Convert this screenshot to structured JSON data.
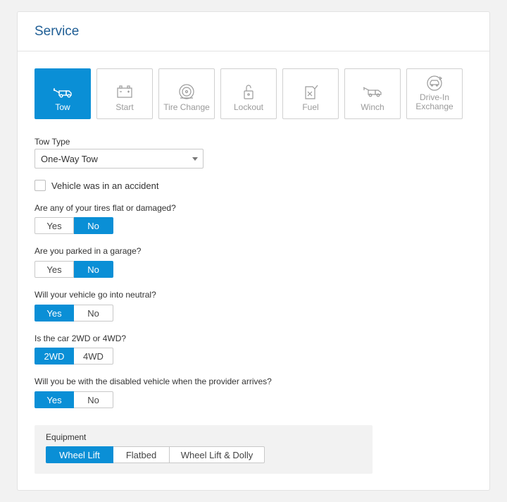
{
  "header": {
    "title": "Service"
  },
  "services": [
    {
      "label": "Tow",
      "icon": "tow-truck-icon",
      "active": true
    },
    {
      "label": "Start",
      "icon": "battery-icon",
      "active": false
    },
    {
      "label": "Tire Change",
      "icon": "tire-icon",
      "active": false
    },
    {
      "label": "Lockout",
      "icon": "unlock-icon",
      "active": false
    },
    {
      "label": "Fuel",
      "icon": "fuel-can-icon",
      "active": false
    },
    {
      "label": "Winch",
      "icon": "winch-truck-icon",
      "active": false
    },
    {
      "label": "Drive-In Exchange",
      "label_line1": "Drive-In",
      "label_line2": "Exchange",
      "icon": "car-exchange-icon",
      "active": false
    }
  ],
  "tow_type": {
    "label": "Tow Type",
    "value": "One-Way Tow"
  },
  "accident": {
    "label": "Vehicle was in an accident",
    "checked": false
  },
  "questions": [
    {
      "label": "Are any of your tires flat or damaged?",
      "options": [
        "Yes",
        "No"
      ],
      "selected": "No"
    },
    {
      "label": "Are you parked in a garage?",
      "options": [
        "Yes",
        "No"
      ],
      "selected": "No"
    },
    {
      "label": "Will your vehicle go into neutral?",
      "options": [
        "Yes",
        "No"
      ],
      "selected": "Yes"
    },
    {
      "label": "Is the car 2WD or 4WD?",
      "options": [
        "2WD",
        "4WD"
      ],
      "selected": "2WD"
    },
    {
      "label": "Will you be with the disabled vehicle when the provider arrives?",
      "options": [
        "Yes",
        "No"
      ],
      "selected": "Yes"
    }
  ],
  "equipment": {
    "label": "Equipment",
    "options": [
      "Wheel Lift",
      "Flatbed",
      "Wheel Lift & Dolly"
    ],
    "selected": "Wheel Lift"
  },
  "colors": {
    "accent": "#0a8fd6",
    "title": "#1f5e95",
    "border": "#c8c8c8"
  }
}
